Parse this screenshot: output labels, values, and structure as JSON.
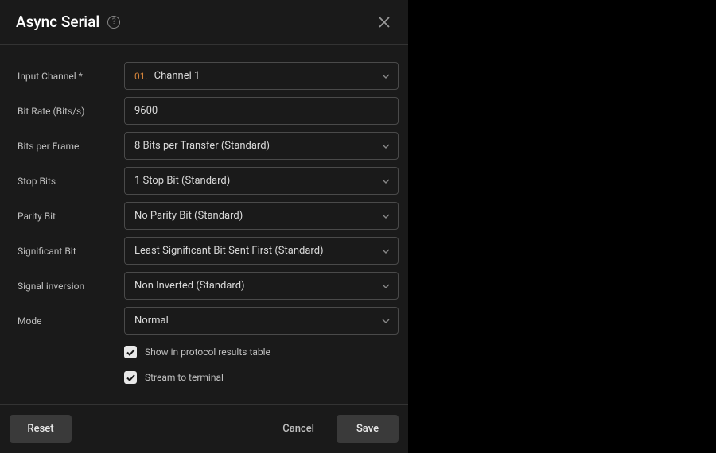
{
  "dialog": {
    "title": "Async Serial"
  },
  "fields": {
    "inputChannel": {
      "label": "Input Channel *",
      "prefix": "01.",
      "value": "Channel 1"
    },
    "bitRate": {
      "label": "Bit Rate (Bits/s)",
      "value": "9600"
    },
    "bitsPerFrame": {
      "label": "Bits per Frame",
      "value": "8 Bits per Transfer (Standard)"
    },
    "stopBits": {
      "label": "Stop Bits",
      "value": "1 Stop Bit (Standard)"
    },
    "parityBit": {
      "label": "Parity Bit",
      "value": "No Parity Bit (Standard)"
    },
    "significantBit": {
      "label": "Significant Bit",
      "value": "Least Significant Bit Sent First (Standard)"
    },
    "signalInversion": {
      "label": "Signal inversion",
      "value": "Non Inverted (Standard)"
    },
    "mode": {
      "label": "Mode",
      "value": "Normal"
    }
  },
  "checkboxes": {
    "showInResults": {
      "label": "Show in protocol results table",
      "checked": true
    },
    "streamTerminal": {
      "label": "Stream to terminal",
      "checked": true
    }
  },
  "buttons": {
    "reset": "Reset",
    "cancel": "Cancel",
    "save": "Save"
  }
}
